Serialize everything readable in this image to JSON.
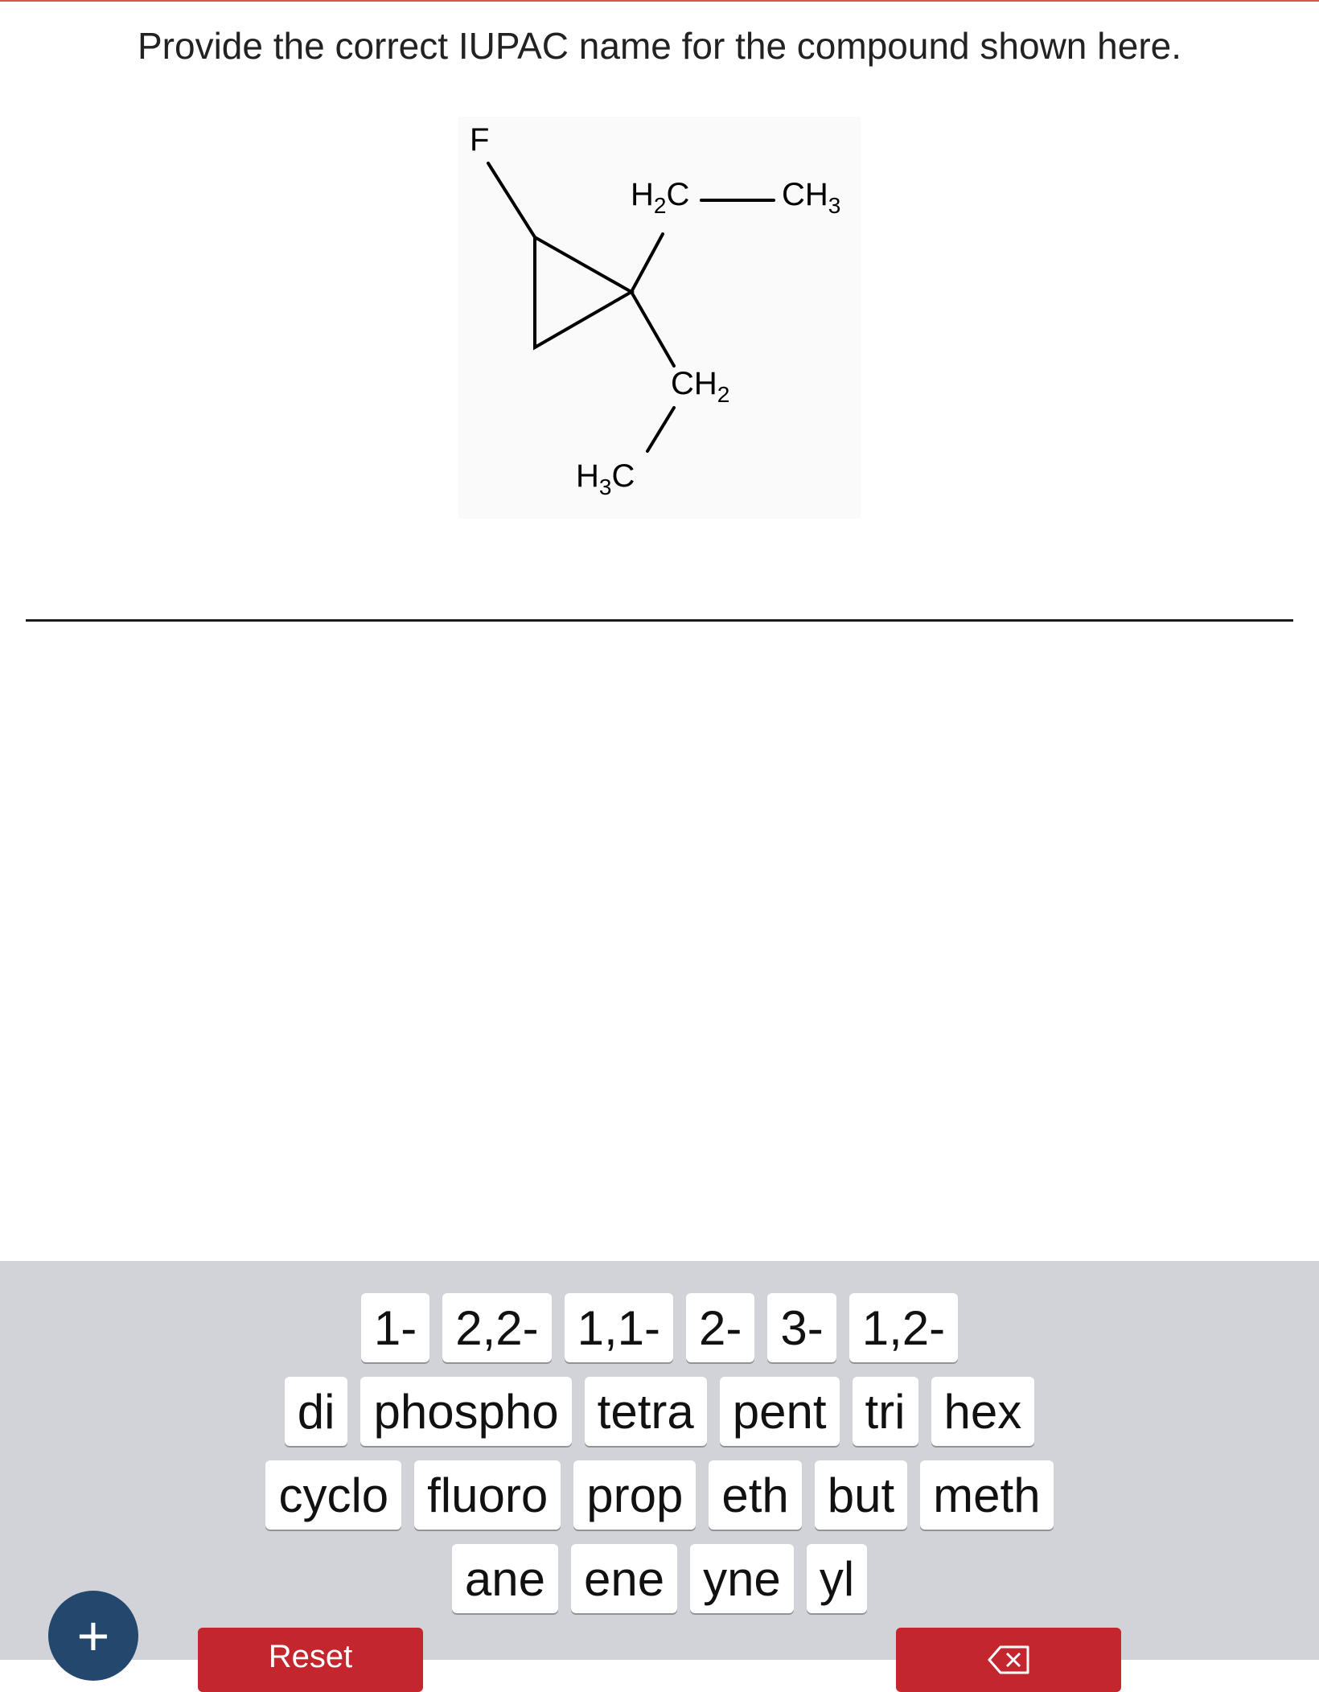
{
  "question": {
    "text": "Provide the correct IUPAC name for the compound shown here."
  },
  "molecule": {
    "labels": {
      "fluorine": "F",
      "ethyl_top_ch2": "H",
      "ethyl_top_ch2_sub": "2",
      "ethyl_top_ch2_c": "C",
      "ethyl_top_ch3_c": "CH",
      "ethyl_top_ch3_sub": "3",
      "ethyl_bottom_ch2": "CH",
      "ethyl_bottom_ch2_sub": "2",
      "ethyl_bottom_ch3_h": "H",
      "ethyl_bottom_ch3_sub": "3",
      "ethyl_bottom_ch3_c": "C"
    }
  },
  "keyboard": {
    "row1": [
      "1-",
      "2,2-",
      "1,1-",
      "2-",
      "3-",
      "1,2-"
    ],
    "row2": [
      "di",
      "phospho",
      "tetra",
      "pent",
      "tri",
      "hex"
    ],
    "row3": [
      "cyclo",
      "fluoro",
      "prop",
      "eth",
      "but",
      "meth"
    ],
    "row4": [
      "ane",
      "ene",
      "yne",
      "yl"
    ]
  },
  "controls": {
    "plus_label": "+",
    "reset_label": "Reset"
  },
  "colors": {
    "accent_red": "#c4262e",
    "plus_blue": "#23476d",
    "keyboard_bg": "#d1d3d9"
  },
  "icons": {
    "backspace": "backspace-icon",
    "plus": "plus-icon"
  }
}
